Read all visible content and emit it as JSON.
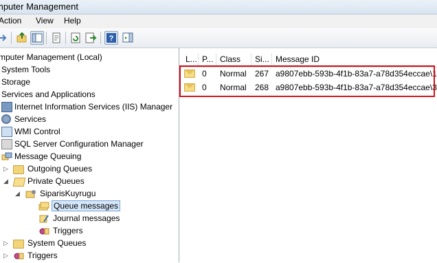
{
  "window": {
    "title": "mputer Management"
  },
  "menu": [
    "Action",
    "View",
    "Help"
  ],
  "toolbar": {
    "buttons": [
      "back-icon",
      "forward-icon",
      "up-folder-icon",
      "show-tree-icon",
      "properties-icon",
      "refresh-icon",
      "export-icon",
      "help-icon",
      "action-pane-icon"
    ]
  },
  "tree": {
    "root": "mputer Management (Local)",
    "system_tools": "System Tools",
    "storage": "Storage",
    "services_apps": "Services and Applications",
    "iis": "Internet Information Services (IIS) Manager",
    "services": "Services",
    "wmi": "WMI Control",
    "sql": "SQL Server Configuration Manager",
    "msmq": "Message Queuing",
    "outgoing": "Outgoing Queues",
    "private": "Private Queues",
    "queue_name": "SiparisKuyrugu",
    "queue_messages": "Queue messages",
    "journal_messages": "Journal messages",
    "triggers_child": "Triggers",
    "system_queues": "System Queues",
    "triggers": "Triggers"
  },
  "list": {
    "columns": [
      "L...",
      "P...",
      "Class",
      "Si...",
      "Message ID"
    ],
    "rows": [
      {
        "priority": "0",
        "class": "Normal",
        "size": "267",
        "id": "a9807ebb-593b-4f1b-83a7-a78d354eccae\\1"
      },
      {
        "priority": "0",
        "class": "Normal",
        "size": "268",
        "id": "a9807ebb-593b-4f1b-83a7-a78d354eccae\\3"
      }
    ]
  }
}
